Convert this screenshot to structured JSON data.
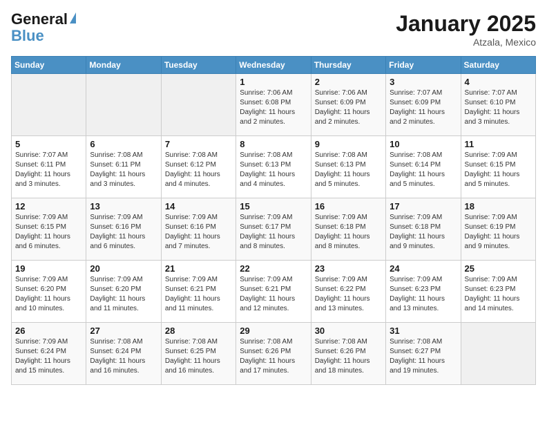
{
  "logo": {
    "line1": "General",
    "line2": "Blue"
  },
  "calendar": {
    "title": "January 2025",
    "subtitle": "Atzala, Mexico"
  },
  "days_of_week": [
    "Sunday",
    "Monday",
    "Tuesday",
    "Wednesday",
    "Thursday",
    "Friday",
    "Saturday"
  ],
  "weeks": [
    [
      {
        "day": "",
        "info": ""
      },
      {
        "day": "",
        "info": ""
      },
      {
        "day": "",
        "info": ""
      },
      {
        "day": "1",
        "info": "Sunrise: 7:06 AM\nSunset: 6:08 PM\nDaylight: 11 hours and 2 minutes."
      },
      {
        "day": "2",
        "info": "Sunrise: 7:06 AM\nSunset: 6:09 PM\nDaylight: 11 hours and 2 minutes."
      },
      {
        "day": "3",
        "info": "Sunrise: 7:07 AM\nSunset: 6:09 PM\nDaylight: 11 hours and 2 minutes."
      },
      {
        "day": "4",
        "info": "Sunrise: 7:07 AM\nSunset: 6:10 PM\nDaylight: 11 hours and 3 minutes."
      }
    ],
    [
      {
        "day": "5",
        "info": "Sunrise: 7:07 AM\nSunset: 6:11 PM\nDaylight: 11 hours and 3 minutes."
      },
      {
        "day": "6",
        "info": "Sunrise: 7:08 AM\nSunset: 6:11 PM\nDaylight: 11 hours and 3 minutes."
      },
      {
        "day": "7",
        "info": "Sunrise: 7:08 AM\nSunset: 6:12 PM\nDaylight: 11 hours and 4 minutes."
      },
      {
        "day": "8",
        "info": "Sunrise: 7:08 AM\nSunset: 6:13 PM\nDaylight: 11 hours and 4 minutes."
      },
      {
        "day": "9",
        "info": "Sunrise: 7:08 AM\nSunset: 6:13 PM\nDaylight: 11 hours and 5 minutes."
      },
      {
        "day": "10",
        "info": "Sunrise: 7:08 AM\nSunset: 6:14 PM\nDaylight: 11 hours and 5 minutes."
      },
      {
        "day": "11",
        "info": "Sunrise: 7:09 AM\nSunset: 6:15 PM\nDaylight: 11 hours and 5 minutes."
      }
    ],
    [
      {
        "day": "12",
        "info": "Sunrise: 7:09 AM\nSunset: 6:15 PM\nDaylight: 11 hours and 6 minutes."
      },
      {
        "day": "13",
        "info": "Sunrise: 7:09 AM\nSunset: 6:16 PM\nDaylight: 11 hours and 6 minutes."
      },
      {
        "day": "14",
        "info": "Sunrise: 7:09 AM\nSunset: 6:16 PM\nDaylight: 11 hours and 7 minutes."
      },
      {
        "day": "15",
        "info": "Sunrise: 7:09 AM\nSunset: 6:17 PM\nDaylight: 11 hours and 8 minutes."
      },
      {
        "day": "16",
        "info": "Sunrise: 7:09 AM\nSunset: 6:18 PM\nDaylight: 11 hours and 8 minutes."
      },
      {
        "day": "17",
        "info": "Sunrise: 7:09 AM\nSunset: 6:18 PM\nDaylight: 11 hours and 9 minutes."
      },
      {
        "day": "18",
        "info": "Sunrise: 7:09 AM\nSunset: 6:19 PM\nDaylight: 11 hours and 9 minutes."
      }
    ],
    [
      {
        "day": "19",
        "info": "Sunrise: 7:09 AM\nSunset: 6:20 PM\nDaylight: 11 hours and 10 minutes."
      },
      {
        "day": "20",
        "info": "Sunrise: 7:09 AM\nSunset: 6:20 PM\nDaylight: 11 hours and 11 minutes."
      },
      {
        "day": "21",
        "info": "Sunrise: 7:09 AM\nSunset: 6:21 PM\nDaylight: 11 hours and 11 minutes."
      },
      {
        "day": "22",
        "info": "Sunrise: 7:09 AM\nSunset: 6:21 PM\nDaylight: 11 hours and 12 minutes."
      },
      {
        "day": "23",
        "info": "Sunrise: 7:09 AM\nSunset: 6:22 PM\nDaylight: 11 hours and 13 minutes."
      },
      {
        "day": "24",
        "info": "Sunrise: 7:09 AM\nSunset: 6:23 PM\nDaylight: 11 hours and 13 minutes."
      },
      {
        "day": "25",
        "info": "Sunrise: 7:09 AM\nSunset: 6:23 PM\nDaylight: 11 hours and 14 minutes."
      }
    ],
    [
      {
        "day": "26",
        "info": "Sunrise: 7:09 AM\nSunset: 6:24 PM\nDaylight: 11 hours and 15 minutes."
      },
      {
        "day": "27",
        "info": "Sunrise: 7:08 AM\nSunset: 6:24 PM\nDaylight: 11 hours and 16 minutes."
      },
      {
        "day": "28",
        "info": "Sunrise: 7:08 AM\nSunset: 6:25 PM\nDaylight: 11 hours and 16 minutes."
      },
      {
        "day": "29",
        "info": "Sunrise: 7:08 AM\nSunset: 6:26 PM\nDaylight: 11 hours and 17 minutes."
      },
      {
        "day": "30",
        "info": "Sunrise: 7:08 AM\nSunset: 6:26 PM\nDaylight: 11 hours and 18 minutes."
      },
      {
        "day": "31",
        "info": "Sunrise: 7:08 AM\nSunset: 6:27 PM\nDaylight: 11 hours and 19 minutes."
      },
      {
        "day": "",
        "info": ""
      }
    ]
  ]
}
